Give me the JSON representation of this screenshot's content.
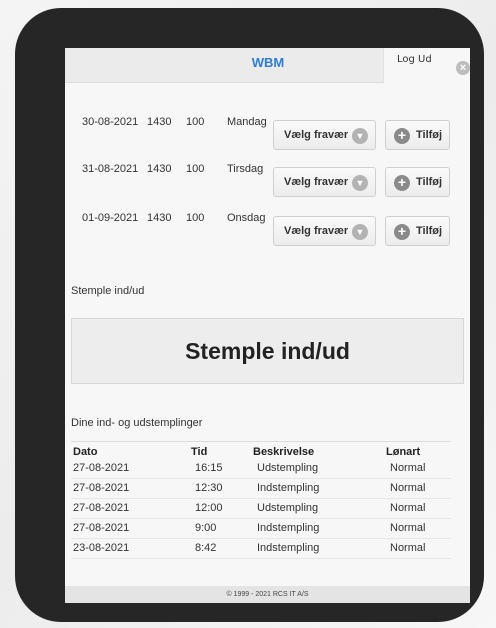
{
  "header": {
    "logo_text": "WBM",
    "logout_label": "Log Ud",
    "close_symbol": "×"
  },
  "absence_rows": [
    {
      "date": "30-08-2021",
      "time": "1430",
      "value": "100",
      "day": "Mandag",
      "select_label": "Vælg fravær",
      "add_label": "Tilføj"
    },
    {
      "date": "31-08-2021",
      "time": "1430",
      "value": "100",
      "day": "Tirsdag",
      "select_label": "Vælg fravær",
      "add_label": "Tilføj"
    },
    {
      "date": "01-09-2021",
      "time": "1430",
      "value": "100",
      "day": "Onsdag",
      "select_label": "Vælg fravær",
      "add_label": "Tilføj"
    }
  ],
  "stamp": {
    "section_label": "Stemple ind/ud",
    "button_label": "Stemple ind/ud"
  },
  "stampings": {
    "section_label": "Dine ind- og udstemplinger",
    "headers": {
      "date": "Dato",
      "time": "Tid",
      "description": "Beskrivelse",
      "pay_type": "Lønart"
    },
    "rows": [
      {
        "date": "27-08-2021",
        "time": "16:15",
        "description": "Udstempling",
        "pay_type": "Normal"
      },
      {
        "date": "27-08-2021",
        "time": "12:30",
        "description": "Indstempling",
        "pay_type": "Normal"
      },
      {
        "date": "27-08-2021",
        "time": "12:00",
        "description": "Udstempling",
        "pay_type": "Normal"
      },
      {
        "date": "27-08-2021",
        "time": "9:00",
        "description": "Indstempling",
        "pay_type": "Normal"
      },
      {
        "date": "23-08-2021",
        "time": "8:42",
        "description": "Indstempling",
        "pay_type": "Normal"
      }
    ]
  },
  "footer": {
    "copyright": "© 1999 - 2021 RCS IT A/S"
  },
  "icons": {
    "chevron": "chevron-down-icon",
    "add": "plus-circle-icon",
    "close": "close-icon"
  },
  "colors": {
    "logo": "#2a7fd4",
    "frame": "#262626"
  }
}
